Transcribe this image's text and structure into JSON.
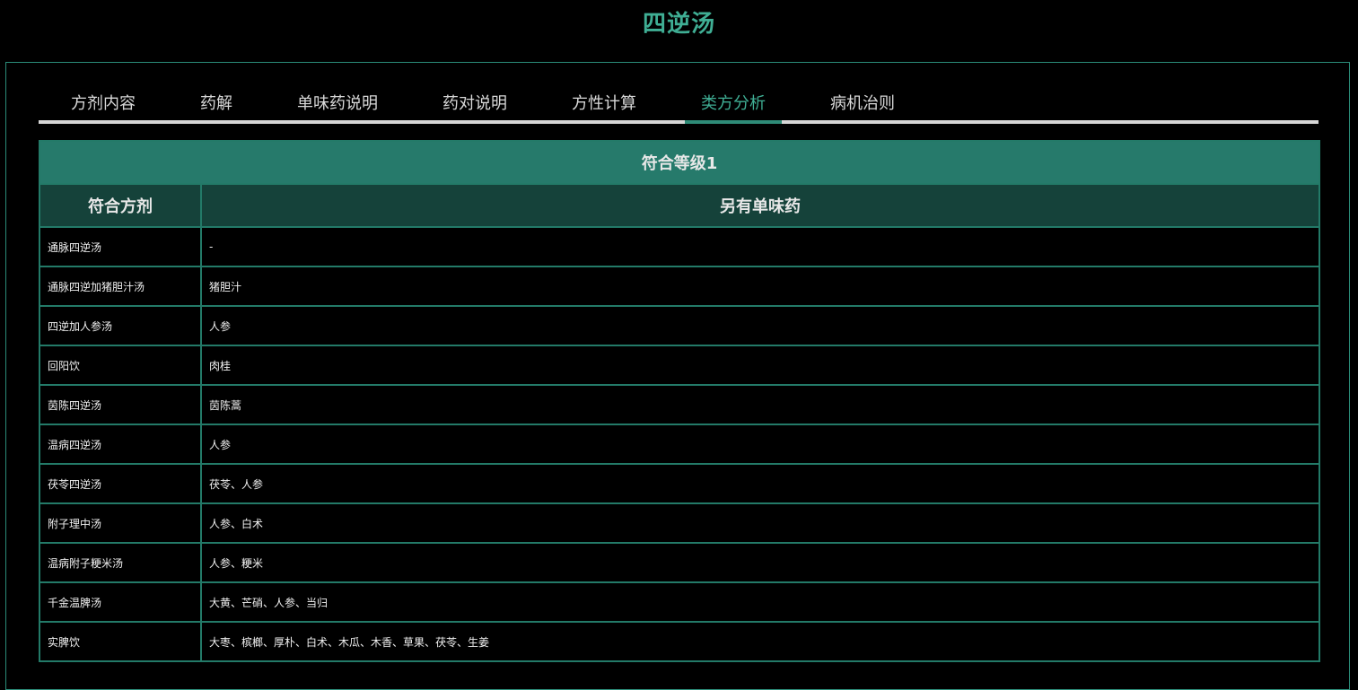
{
  "page": {
    "title": "四逆汤"
  },
  "tabs": [
    {
      "label": "方剂内容",
      "active": false
    },
    {
      "label": "药解",
      "active": false
    },
    {
      "label": "单味药说明",
      "active": false
    },
    {
      "label": "药对说明",
      "active": false
    },
    {
      "label": "方性计算",
      "active": false
    },
    {
      "label": "类方分析",
      "active": true
    },
    {
      "label": "病机治则",
      "active": false
    }
  ],
  "table": {
    "level_title": "符合等级1",
    "columns": [
      "符合方剂",
      "另有单味药"
    ],
    "rows": [
      {
        "formula": "通脉四逆汤",
        "extra": "-"
      },
      {
        "formula": "通脉四逆加猪胆汁汤",
        "extra": "猪胆汁"
      },
      {
        "formula": "四逆加人参汤",
        "extra": "人参"
      },
      {
        "formula": "回阳饮",
        "extra": "肉桂"
      },
      {
        "formula": "茵陈四逆汤",
        "extra": "茵陈蒿"
      },
      {
        "formula": "温病四逆汤",
        "extra": "人参"
      },
      {
        "formula": "茯苓四逆汤",
        "extra": "茯苓、人参"
      },
      {
        "formula": "附子理中汤",
        "extra": "人参、白术"
      },
      {
        "formula": "温病附子粳米汤",
        "extra": "人参、粳米"
      },
      {
        "formula": "千金温脾汤",
        "extra": "大黄、芒硝、人参、当归"
      },
      {
        "formula": "实脾饮",
        "extra": "大枣、槟榔、厚朴、白术、木瓜、木香、草果、茯苓、生姜"
      }
    ]
  },
  "colors": {
    "accent": "#3fae94",
    "border": "#237a68",
    "level_header_bg": "#267a6b",
    "column_header_bg": "#15423a",
    "background": "#000000"
  }
}
